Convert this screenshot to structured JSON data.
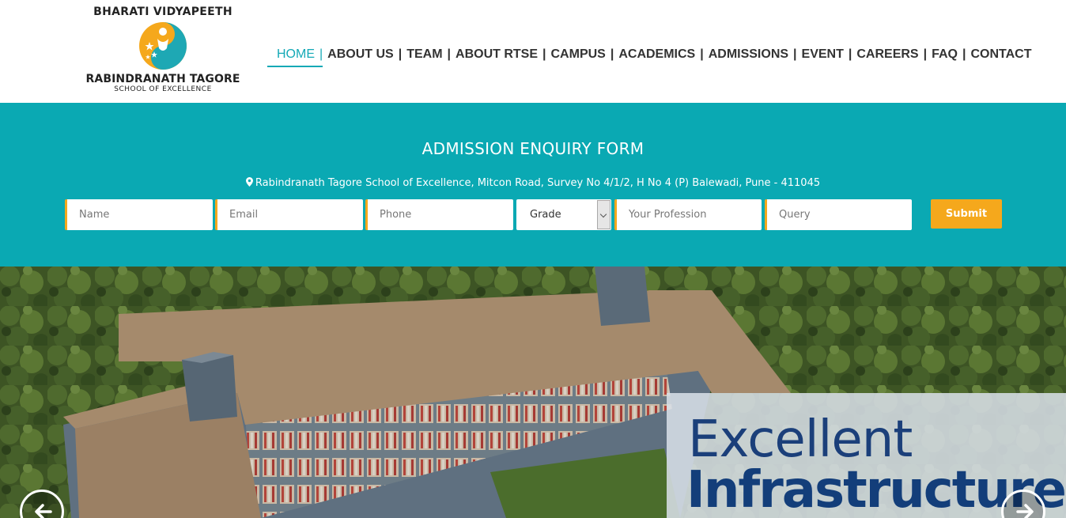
{
  "header": {
    "logo": {
      "top_text": "BHARATI VIDYAPEETH",
      "main_text": "RABINDRANATH TAGORE",
      "sub_text": "SCHOOL OF EXCELLENCE",
      "icon": "school-emblem-icon"
    },
    "nav": [
      {
        "label": "HOME",
        "active": true
      },
      {
        "label": "ABOUT US",
        "active": false
      },
      {
        "label": "TEAM",
        "active": false
      },
      {
        "label": "ABOUT RTSE",
        "active": false
      },
      {
        "label": "CAMPUS",
        "active": false
      },
      {
        "label": "ACADEMICS",
        "active": false
      },
      {
        "label": "ADMISSIONS",
        "active": false
      },
      {
        "label": "EVENT",
        "active": false
      },
      {
        "label": "CAREERS",
        "active": false
      },
      {
        "label": "FAQ",
        "active": false
      },
      {
        "label": "CONTACT",
        "active": false
      }
    ],
    "separator": "|"
  },
  "enquiry": {
    "title": "ADMISSION ENQUIRY FORM",
    "address": "Rabindranath Tagore School of Excellence, Mitcon Road, Survey No 4/1/2, H No 4 (P) Balewadi, Pune - 411045",
    "address_icon": "map-marker-icon",
    "fields": {
      "name_placeholder": "Name",
      "email_placeholder": "Email",
      "phone_placeholder": "Phone",
      "grade_selected": "Grade",
      "profession_placeholder": "Your Profession",
      "query_placeholder": "Query"
    },
    "submit_label": "Submit"
  },
  "hero": {
    "caption_line1": "Excellent",
    "caption_line2": "Infrastructure",
    "prev_icon": "arrow-left-icon",
    "next_icon": "arrow-right-icon"
  },
  "colors": {
    "accent": "#14a9b6",
    "band": "#0aa9b3",
    "button": "#f5a81c",
    "caption_text": "#1b3f7a"
  }
}
